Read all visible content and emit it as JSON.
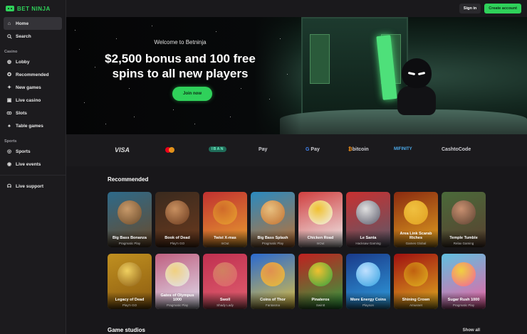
{
  "brand": {
    "name": "BET NINJA",
    "accent": "#2fd15a"
  },
  "header": {
    "signin_label": "Sign in",
    "create_label": "Create account"
  },
  "sidebar": {
    "main": [
      {
        "label": "Home",
        "icon": "home-icon"
      },
      {
        "label": "Search",
        "icon": "search-icon"
      }
    ],
    "casino_label": "Casino",
    "casino": [
      {
        "label": "Lobby",
        "icon": "lobby-icon"
      },
      {
        "label": "Recommended",
        "icon": "star-icon"
      },
      {
        "label": "New games",
        "icon": "sparkle-icon"
      },
      {
        "label": "Live casino",
        "icon": "live-icon"
      },
      {
        "label": "Slots",
        "icon": "cherry-icon"
      },
      {
        "label": "Table games",
        "icon": "spade-icon"
      }
    ],
    "sports_label": "Sports",
    "sports": [
      {
        "label": "Sports",
        "icon": "ball-icon"
      },
      {
        "label": "Live events",
        "icon": "live-dot-icon"
      }
    ],
    "support_label": "Live support"
  },
  "hero": {
    "welcome": "Welcome to Betninja",
    "title_line1": "$2,500 bonus and 100 free",
    "title_line2": "spins to all new players",
    "cta": "Join now"
  },
  "payments": {
    "visa": "VISA",
    "iban": "IBAN",
    "applepay": "Pay",
    "googlepay": "Pay",
    "bitcoin": "bitcoin",
    "mifinity": "MIFINITY",
    "cashtocode": "CashtoCode"
  },
  "recommended": {
    "title": "Recommended",
    "row1": [
      {
        "title": "Big Bass Bonanza",
        "provider": "Pragmatic Play"
      },
      {
        "title": "Book of Dead",
        "provider": "Play'n GO"
      },
      {
        "title": "Twist X-mas",
        "provider": "InOut"
      },
      {
        "title": "Big Bass Splash",
        "provider": "Pragmatic Play"
      },
      {
        "title": "Chicken Road",
        "provider": "InOut"
      },
      {
        "title": "Le Santa",
        "provider": "Hacksaw Gaming"
      },
      {
        "title": "Area Link Scarab Riches",
        "provider": "Games Global"
      },
      {
        "title": "Temple Tumble",
        "provider": "Relax Gaming"
      }
    ],
    "row2": [
      {
        "title": "Legacy of Dead",
        "provider": "Play'n GO"
      },
      {
        "title": "Gates of Olympus 1000",
        "provider": "Pragmatic Play"
      },
      {
        "title": "Swoll",
        "provider": "Shady Lady"
      },
      {
        "title": "Coins of Thor",
        "provider": "Fantasma"
      },
      {
        "title": "Pinateros",
        "provider": "Swintt"
      },
      {
        "title": "More Energy Coins",
        "provider": "Playson"
      },
      {
        "title": "Shining Crown",
        "provider": "Amusnet"
      },
      {
        "title": "Sugar Rush 1000",
        "provider": "Pragmatic Play"
      }
    ]
  },
  "studios": {
    "title": "Game studios",
    "show_all": "Show all"
  }
}
